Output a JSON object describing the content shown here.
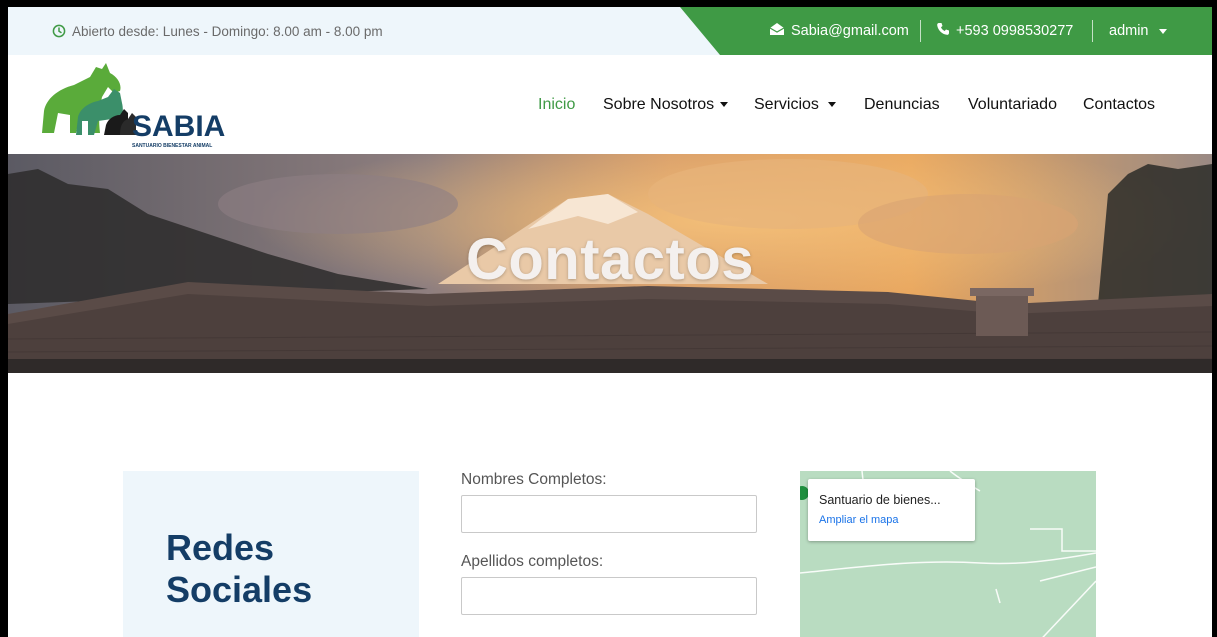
{
  "topbar": {
    "hours": "Abierto desde: Lunes - Domingo: 8.00 am - 8.00 pm",
    "email": "Sabia@gmail.com",
    "phone": "+593 0998530277",
    "user": "admin"
  },
  "brand": {
    "name": "SABIA",
    "tagline": "SANTUARIO BIENESTAR ANIMAL"
  },
  "nav": {
    "items": [
      {
        "label": "Inicio",
        "active": true,
        "dropdown": false
      },
      {
        "label": "Sobre Nosotros",
        "active": false,
        "dropdown": true
      },
      {
        "label": "Servicios",
        "active": false,
        "dropdown": true
      },
      {
        "label": "Denuncias",
        "active": false,
        "dropdown": false
      },
      {
        "label": "Voluntariado",
        "active": false,
        "dropdown": false
      },
      {
        "label": "Contactos",
        "active": false,
        "dropdown": false
      }
    ]
  },
  "hero": {
    "title": "Contactos"
  },
  "social": {
    "title": "Redes Sociales"
  },
  "form": {
    "first_name_label": "Nombres Completos:",
    "last_name_label": "Apellidos completos:"
  },
  "map": {
    "place": "Santuario de bienes...",
    "link": "Ampliar el mapa"
  },
  "colors": {
    "accent_green": "#3f9a45",
    "topbar_bg": "#eef6fb",
    "heading_navy": "#143d66"
  },
  "icons": {
    "clock": "clock-icon",
    "email": "envelope-icon",
    "phone": "phone-icon",
    "caret": "caret-down-icon"
  }
}
